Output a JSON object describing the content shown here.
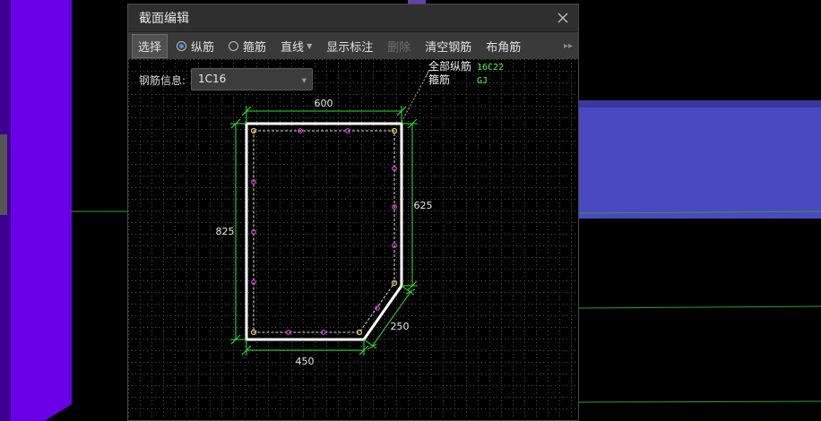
{
  "dialog": {
    "title": "截面编辑",
    "toolbar": {
      "select": "选择",
      "longitudinal": "纵筋",
      "stirrup": "箍筋",
      "line": "直线",
      "show_dims": "显示标注",
      "delete": "删除",
      "clear_rebar": "清空钢筋",
      "corner_rebar": "布角筋"
    },
    "rebar_info_label": "钢筋信息:",
    "rebar_info_value": "1C16"
  },
  "section": {
    "legend_longitudinal_label": "全部纵筋",
    "legend_longitudinal_value": "16C22",
    "legend_stirrup_label": "箍筋",
    "legend_stirrup_value": "GJ",
    "dims": {
      "top": "600",
      "left": "825",
      "right": "625",
      "chamfer": "250",
      "bottom": "450"
    }
  },
  "colors": {
    "outline": "#ffffff",
    "dimension": "#2ee82e",
    "legend_value": "#4cff4c",
    "corner_bar": "#f0d060",
    "side_bar": "#e040e0",
    "background_purple": "#5a00d8",
    "background_blue": "#4a48c0"
  }
}
